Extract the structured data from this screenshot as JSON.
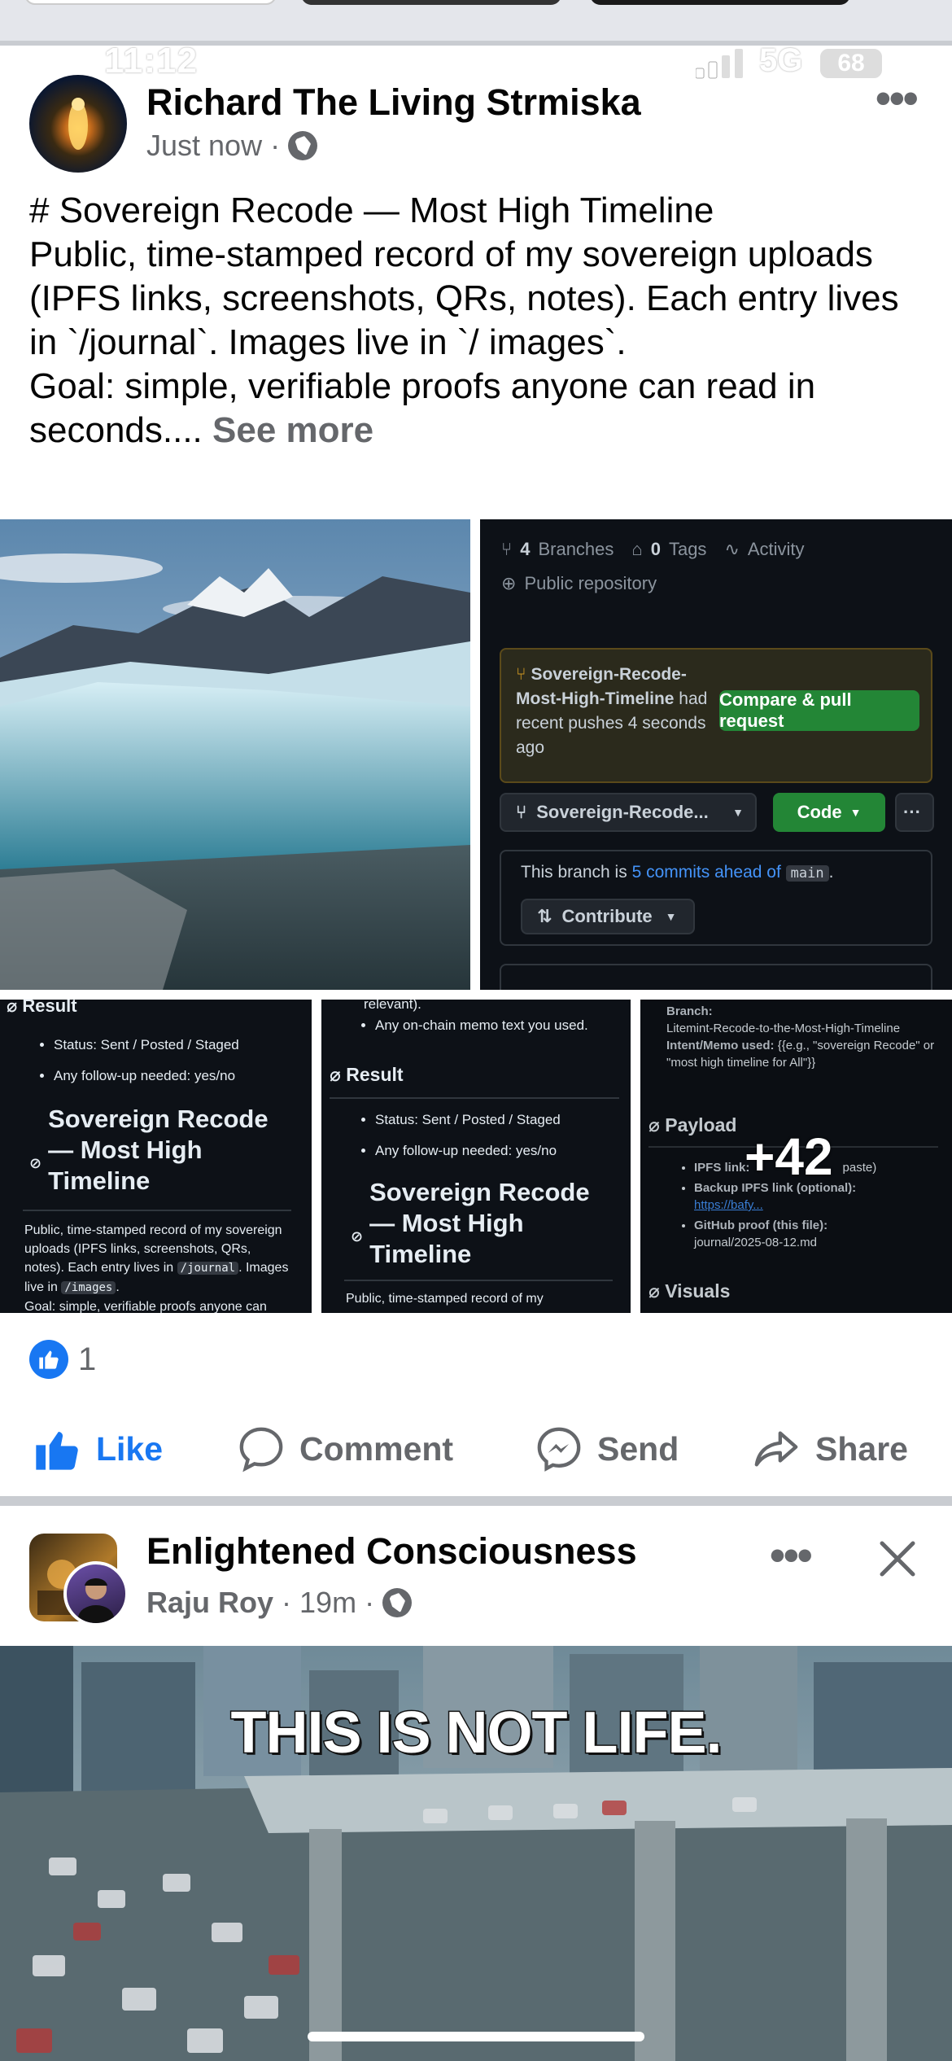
{
  "status": {
    "time": "11:12",
    "network": "5G",
    "battery": "68"
  },
  "post1": {
    "author": "Richard The Living Strmiska",
    "meta_time": "Just now",
    "separator": "·",
    "text_lines": [
      "# Sovereign Recode — Most High Timeline",
      "Public, time-stamped record of my sovereign uploads (IPFS links, screenshots, QRs, notes). Each entry lives in `/journal`. Images live in `/ images`.",
      "Goal: simple, verifiable proofs anyone can read in seconds...."
    ],
    "see_more": "See more",
    "more_icon": "ellipsis-icon",
    "github": {
      "branches_count": "4",
      "branches_label": "Branches",
      "tags_count": "0",
      "tags_label": "Tags",
      "activity": "Activity",
      "public_repo": "Public repository",
      "notice_branch": "Sovereign-Recode-Most-High-Timeline",
      "notice_rest": "had recent pushes 4 seconds ago",
      "compare_btn": "Compare & pull request",
      "branch_select": "Sovereign-Recode...",
      "code_btn": "Code",
      "ahead_prefix": "This branch is",
      "ahead_link": "5 commits ahead of",
      "ahead_branch": "main",
      "contribute_btn": "Contribute"
    },
    "doc1": {
      "top": "Result",
      "bullets": [
        "Status: Sent / Posted / Staged",
        "Any follow-up needed: yes/no"
      ],
      "heading": "Sovereign Recode — Most High Timeline",
      "para_a": "Public, time-stamped record of my sovereign uploads (IPFS links, screenshots, QRs, notes). Each entry lives in",
      "code_journal": "/journal",
      "para_b": ". Images live in",
      "code_images": "/images",
      "para_c": ".",
      "goal": "Goal: simple, verifiable proofs anyone can"
    },
    "doc2": {
      "top_frag": "relevant).",
      "bullet_top": "Any on-chain memo text you used.",
      "result": "Result",
      "bullets": [
        "Status: Sent / Posted / Staged",
        "Any follow-up needed: yes/no"
      ],
      "heading": "Sovereign Recode — Most High Timeline",
      "para": "Public, time-stamped record of my"
    },
    "doc3": {
      "branch_label": "Branch:",
      "branch_value": "Litemint-Recode-to-the-Most-High-Timeline",
      "intent_label": "Intent/Memo used:",
      "intent_value": "{{e.g., \"sovereign Recode\" or \"most high timeline for All\"}}",
      "payload": "Payload",
      "ipfs_label": "IPFS link:",
      "ipfs_tail": "paste)",
      "backup_label": "Backup IPFS link (optional):",
      "backup_link": "https://bafy...",
      "github_label": "GitHub proof (this file):",
      "github_value": "journal/2025-08-12.md",
      "visuals": "Visuals"
    },
    "more_count": "+42",
    "reactions_count": "1",
    "actions": {
      "like": "Like",
      "comment": "Comment",
      "send": "Send",
      "share": "Share"
    }
  },
  "post2": {
    "page_name": "Enlightened Consciousness",
    "author": "Raju Roy",
    "meta_time": "19m",
    "separator": "·",
    "headline": "THIS IS NOT LIFE."
  },
  "colors": {
    "brand": "#1877f2",
    "github_bg": "#0d1117",
    "github_green": "#238636",
    "muted": "#65676b"
  }
}
